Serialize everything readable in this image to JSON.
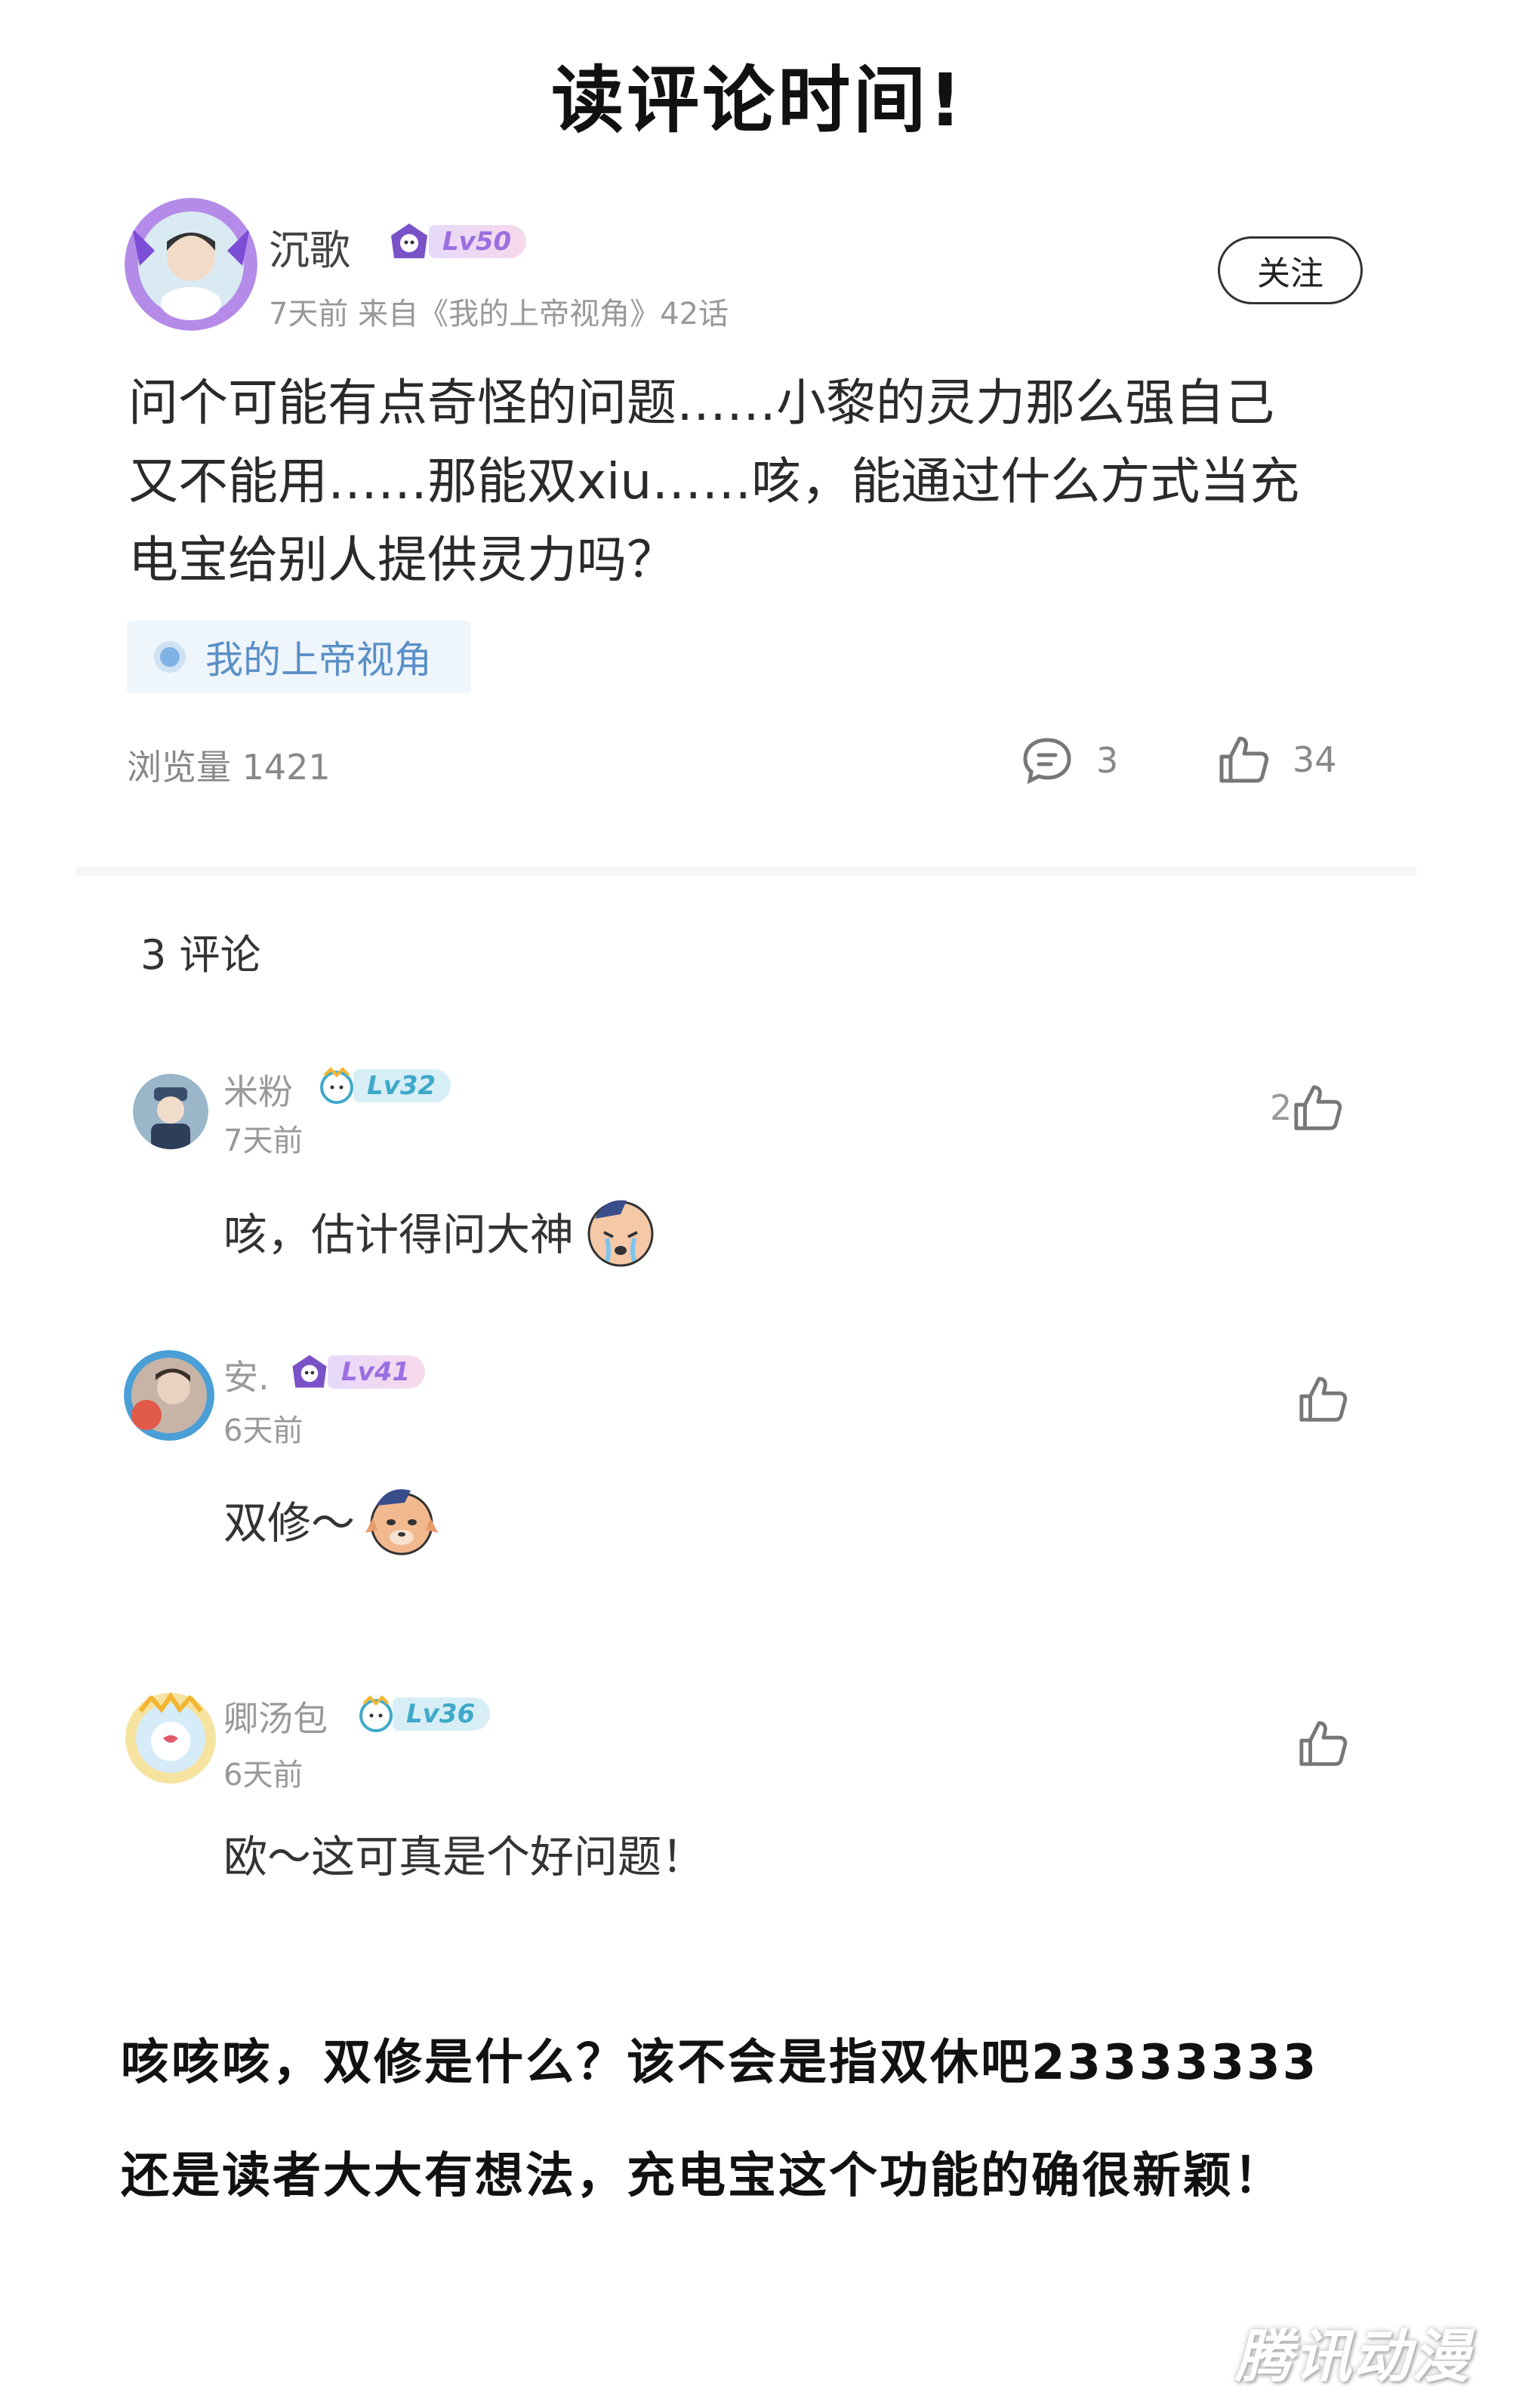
{
  "page_title": "读评论时间!",
  "post": {
    "author": "沉歌",
    "level": "Lv50",
    "meta": "7天前  来自《我的上帝视角》42话",
    "follow_label": "关注",
    "body_lines": [
      "问个可能有点奇怪的问题……小黎的灵力那么强自己",
      "又不能用……那能双xiu……咳，能通过什么方式当充",
      "电宝给别人提供灵力吗？"
    ],
    "topic": "我的上帝视角",
    "views": "浏览量 1421",
    "comment_count": "3",
    "like_count": "34"
  },
  "comments_header": "3 评论",
  "comments": [
    {
      "author": "米粉",
      "level": "Lv32",
      "time": "7天前",
      "text": "咳，估计得问大神",
      "likes": "2"
    },
    {
      "author": "安.",
      "level": "Lv41",
      "time": "6天前",
      "text": "双修～",
      "likes": ""
    },
    {
      "author": "卿汤包",
      "level": "Lv36",
      "time": "6天前",
      "text": "欧～这可真是个好问题！",
      "likes": ""
    }
  ],
  "footer": {
    "line1": "咳咳咳，双修是什么？该不会是指双休吧23333333",
    "line2": "还是读者大大有想法，充电宝这个功能的确很新颖！"
  },
  "watermark": "腾讯动漫",
  "colors": {
    "lv_purple": "#9b6fe0",
    "lv_teal": "#3fa9c9",
    "topic_blue": "#5a8fc7"
  }
}
